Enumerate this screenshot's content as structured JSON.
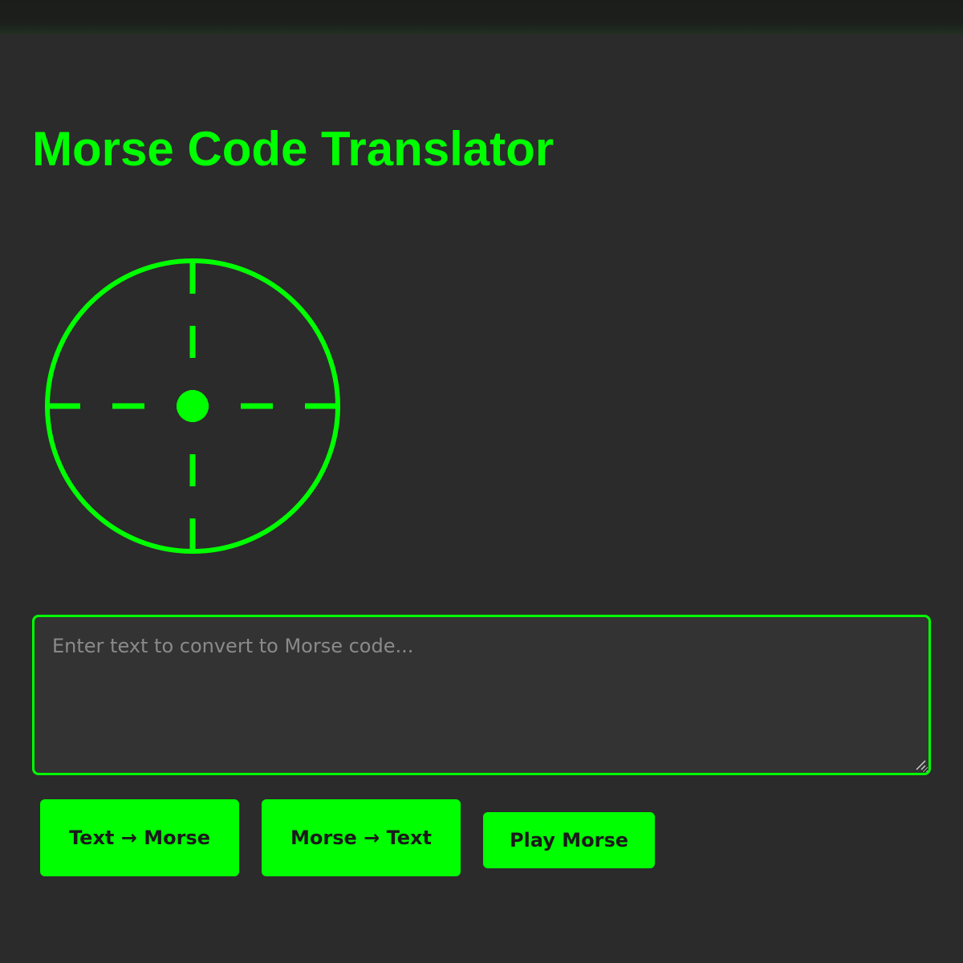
{
  "page": {
    "title": "Morse Code Translator"
  },
  "input": {
    "value": "",
    "placeholder": "Enter text to convert to Morse code..."
  },
  "buttons": {
    "text_to_morse": "Text → Morse",
    "morse_to_text": "Morse → Text",
    "play_morse": "Play Morse"
  },
  "icons": {
    "dial": "morse-dial-icon",
    "resize": "resize-handle-icon"
  },
  "colors": {
    "accent": "#00ff00",
    "background": "#2b2b2b",
    "input_background": "#333333",
    "button_text": "#1a1a1a"
  }
}
